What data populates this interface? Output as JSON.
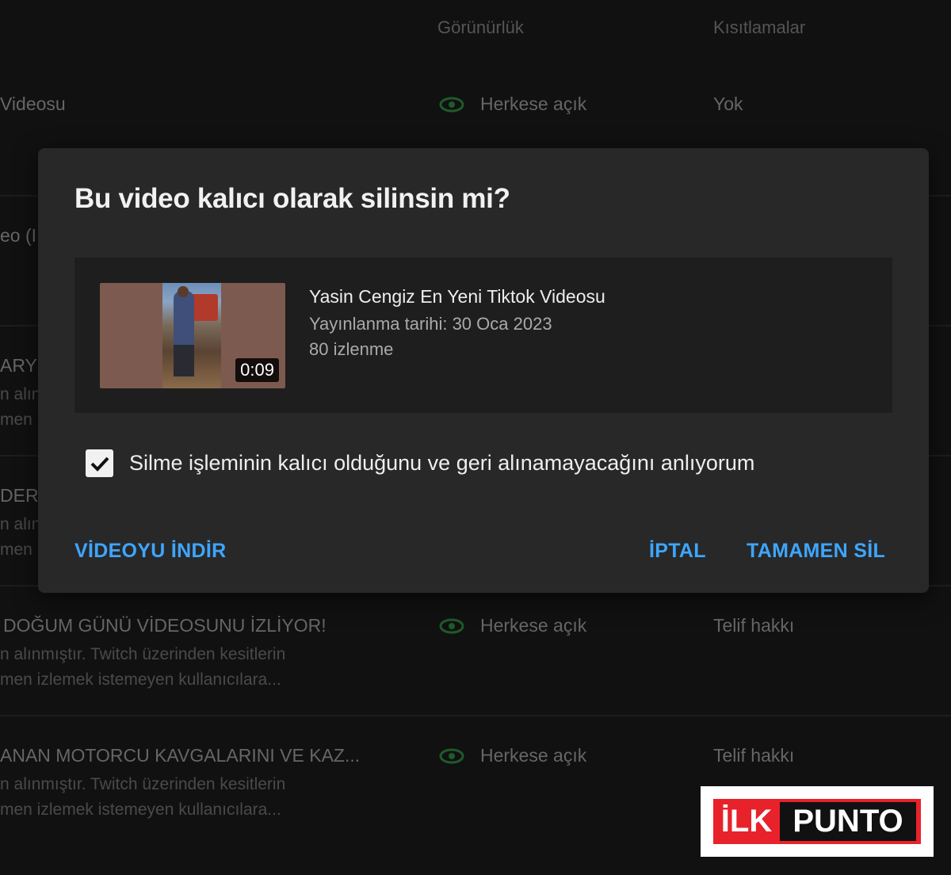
{
  "background": {
    "headers": {
      "visibility": "Görünürlük",
      "restrictions": "Kısıtlamalar"
    },
    "rows": [
      {
        "title": "Videosu",
        "desc1": "",
        "desc2": "",
        "visibility": "Herkese açık",
        "restriction": "Yok"
      },
      {
        "title": "eo (I",
        "desc1": "",
        "desc2": "",
        "visibility": "",
        "restriction": ""
      },
      {
        "title": "ARYU",
        "desc1": "n alın",
        "desc2": "men",
        "visibility": "",
        "restriction": ""
      },
      {
        "title": "DERİ",
        "desc1": "n alın",
        "desc2": "men",
        "visibility": "",
        "restriction": ""
      },
      {
        "title": "DOĞUM GÜNÜ VİDEOSUNU İZLİYOR!",
        "desc1": "n alınmıştır. Twitch üzerinden kesitlerin",
        "desc2": "men izlemek istemeyen kullanıcılara...",
        "visibility": "Herkese açık",
        "restriction": "Telif hakkı"
      },
      {
        "title": "ANAN MOTORCU KAVGALARINI VE KAZ...",
        "desc1": "n alınmıştır. Twitch üzerinden kesitlerin",
        "desc2": "men izlemek istemeyen kullanıcılara...",
        "visibility": "Herkese açık",
        "restriction": "Telif hakkı"
      }
    ]
  },
  "dialog": {
    "title": "Bu video kalıcı olarak silinsin mi?",
    "video": {
      "title": "Yasin Cengiz En Yeni Tiktok Videosu",
      "published": "Yayınlanma tarihi: 30 Oca 2023",
      "views": "80 izlenme",
      "duration": "0:09"
    },
    "confirm_label": "Silme işleminin kalıcı olduğunu ve geri alınamayacağını anlıyorum",
    "confirm_checked": true,
    "buttons": {
      "download": "VİDEOYU İNDİR",
      "cancel": "İPTAL",
      "delete": "TAMAMEN SİL"
    },
    "accent_color": "#3ea6ff"
  },
  "watermark": {
    "left": "İLK",
    "right": "PUNTO"
  }
}
